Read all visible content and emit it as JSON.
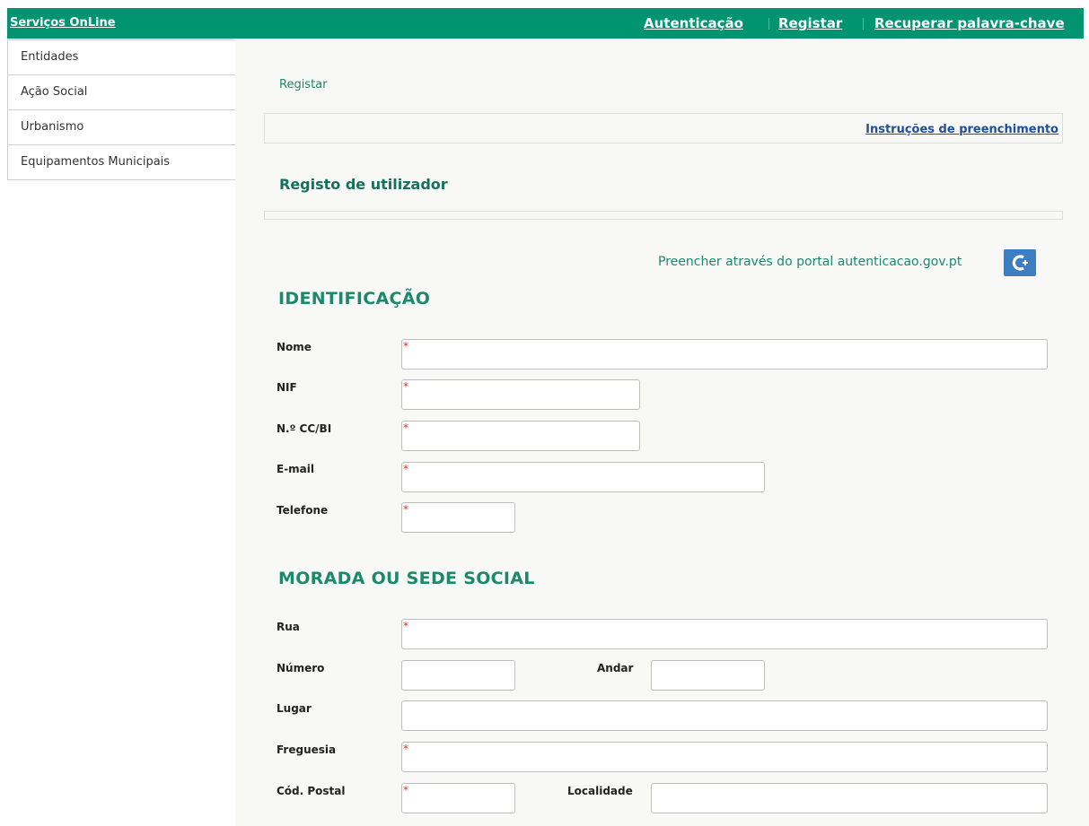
{
  "topbar": {
    "brand": "Serviços OnLine",
    "links": [
      "Autenticação",
      "Registar",
      "Recuperar palavra-chave"
    ]
  },
  "sidebar": {
    "items": [
      {
        "label": "Entidades"
      },
      {
        "label": "Ação Social"
      },
      {
        "label": "Urbanismo"
      },
      {
        "label": "Equipamentos Municipais"
      }
    ]
  },
  "main": {
    "breadcrumb": "Registar",
    "instructions_link": "Instruções de preenchimento",
    "title": "Registo de utilizador",
    "portal_text": "Preencher através do portal autenticacao.gov.pt",
    "portal_icon": "autenticacao-gov-icon",
    "required_mark": "*"
  },
  "identificacao": {
    "heading": "IDENTIFICAÇÃO",
    "nome_label": "Nome",
    "nif_label": "NIF",
    "cc_label": "N.º CC/BI",
    "email_label": "E-mail",
    "telefone_label": "Telefone"
  },
  "morada": {
    "heading": "MORADA OU SEDE SOCIAL",
    "rua_label": "Rua",
    "numero_label": "Número",
    "andar_label": "Andar",
    "lugar_label": "Lugar",
    "freguesia_label": "Freguesia",
    "cod_postal_label": "Cód. Postal",
    "localidade_label": "Localidade"
  },
  "colors": {
    "brand_green": "#009570",
    "link_blue": "#1f4e9c",
    "required_red": "#e0301e"
  }
}
